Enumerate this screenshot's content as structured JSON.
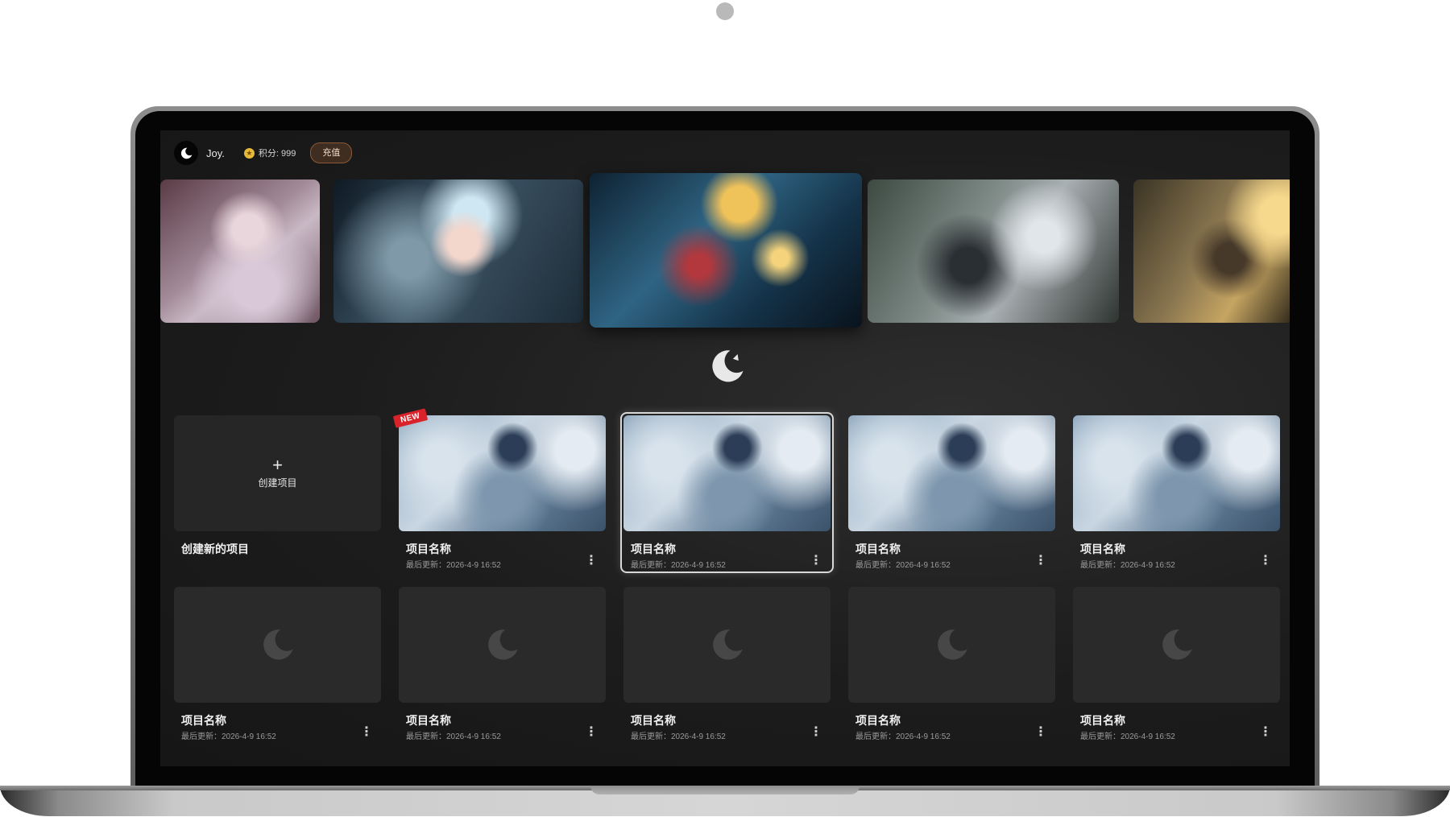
{
  "user": {
    "name": "Joy.",
    "points_label": "积分: 999",
    "recharge_label": "充值"
  },
  "carousel": [
    {
      "name": "carousel-slide-1",
      "active": false
    },
    {
      "name": "carousel-slide-2",
      "active": false
    },
    {
      "name": "carousel-slide-3",
      "active": true
    },
    {
      "name": "carousel-slide-4",
      "active": false
    },
    {
      "name": "carousel-slide-5",
      "active": false
    }
  ],
  "create": {
    "button_label": "创建项目",
    "title": "创建新的项目"
  },
  "badge": {
    "new_label": "NEW"
  },
  "row1": [
    {
      "title": "项目名称",
      "updated": "最后更新：2026-4-9 16:52"
    },
    {
      "title": "项目名称",
      "updated": "最后更新：2026-4-9 16:52"
    },
    {
      "title": "项目名称",
      "updated": "最后更新：2026-4-9 16:52"
    },
    {
      "title": "项目名称",
      "updated": "最后更新：2026-4-9 16:52"
    }
  ],
  "row2": [
    {
      "title": "项目名称",
      "updated": "最后更新：2026-4-9 16:52"
    },
    {
      "title": "项目名称",
      "updated": "最后更新：2026-4-9 16:52"
    },
    {
      "title": "项目名称",
      "updated": "最后更新：2026-4-9 16:52"
    },
    {
      "title": "项目名称",
      "updated": "最后更新：2026-4-9 16:52"
    },
    {
      "title": "项目名称",
      "updated": "最后更新：2026-4-9 16:52"
    }
  ],
  "icons": {
    "more": "more-vertical-icon",
    "logo": "moon-logo-icon",
    "coin": "coin-icon",
    "plus": "plus-icon"
  },
  "colors": {
    "background": "#1c1c1c",
    "card": "#2a2a2a",
    "accent_badge": "#d9232b",
    "recharge": "#3f2d22"
  }
}
